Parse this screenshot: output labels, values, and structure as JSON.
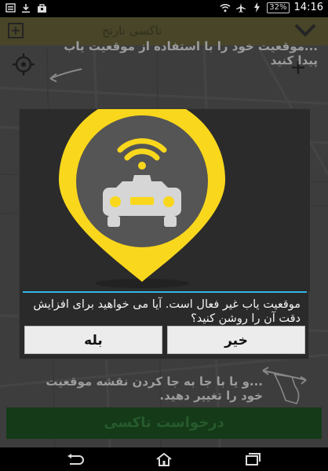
{
  "status_bar": {
    "time": "14:16",
    "battery": "32%",
    "icons_left": [
      "sim-icon",
      "download-icon",
      "bag-icon"
    ],
    "icons_right": [
      "wifi-icon",
      "airplane-icon",
      "charging-icon"
    ]
  },
  "app_bar": {
    "title": "تاکسی نارنج"
  },
  "tips": {
    "top": "...موقعیت خود را با استفاده از موقعیت یاب پیدا کنید",
    "bottom": "...و یا با جا به جا کردن نقشه موقعیت خود را تغییر دهید."
  },
  "request_button": "درخواست تاکسی",
  "dialog": {
    "message": "موقعیت یاب غیر فعال است. آیا می خواهید برای افزایش دقت آن را روشن کنید؟",
    "yes_label": "بله",
    "no_label": "خیر",
    "colors": {
      "accent": "#33b5e5",
      "pin": "#f9d71c",
      "pin_inner": "#555555"
    }
  },
  "nav_bar": {
    "icons": [
      "back-icon",
      "home-icon",
      "recent-apps-icon"
    ]
  }
}
